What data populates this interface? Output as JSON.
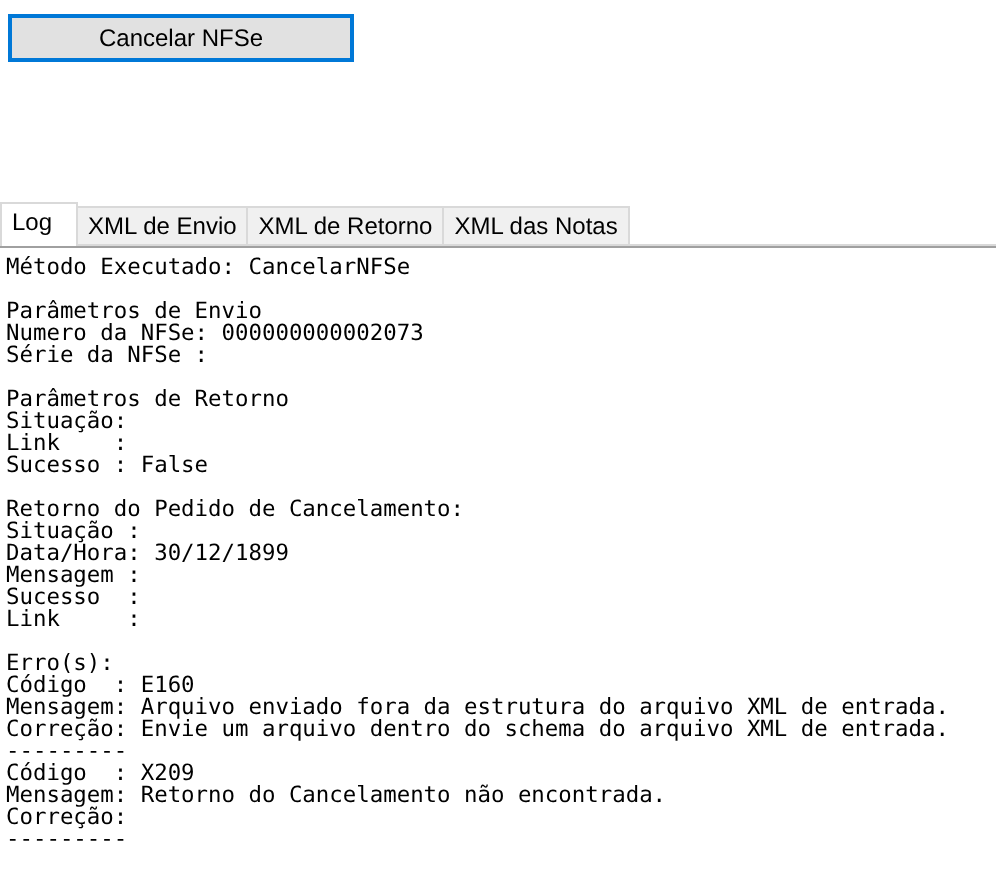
{
  "button": {
    "label": "Cancelar NFSe",
    "focused": true
  },
  "tabs": [
    {
      "label": "Log",
      "selected": true
    },
    {
      "label": "XML de Envio",
      "selected": false
    },
    {
      "label": "XML de Retorno",
      "selected": false
    },
    {
      "label": "XML das Notas",
      "selected": false
    }
  ],
  "log": {
    "sections": [
      [
        "Método Executado: CancelarNFSe"
      ],
      [
        "Parâmetros de Envio",
        "Numero da NFSe: 000000000002073",
        "Série da NFSe :"
      ],
      [
        "Parâmetros de Retorno",
        "Situação:",
        "Link    :",
        "Sucesso : False"
      ],
      [
        "Retorno do Pedido de Cancelamento:",
        "Situação :",
        "Data/Hora: 30/12/1899",
        "Mensagem :",
        "Sucesso  :",
        "Link     :"
      ],
      [
        "Erro(s):",
        "Código  : E160",
        "Mensagem: Arquivo enviado fora da estrutura do arquivo XML de entrada.",
        "Correção: Envie um arquivo dentro do schema do arquivo XML de entrada.",
        "---------",
        "Código  : X209",
        "Mensagem: Retorno do Cancelamento não encontrada.",
        "Correção:",
        "---------"
      ]
    ]
  }
}
